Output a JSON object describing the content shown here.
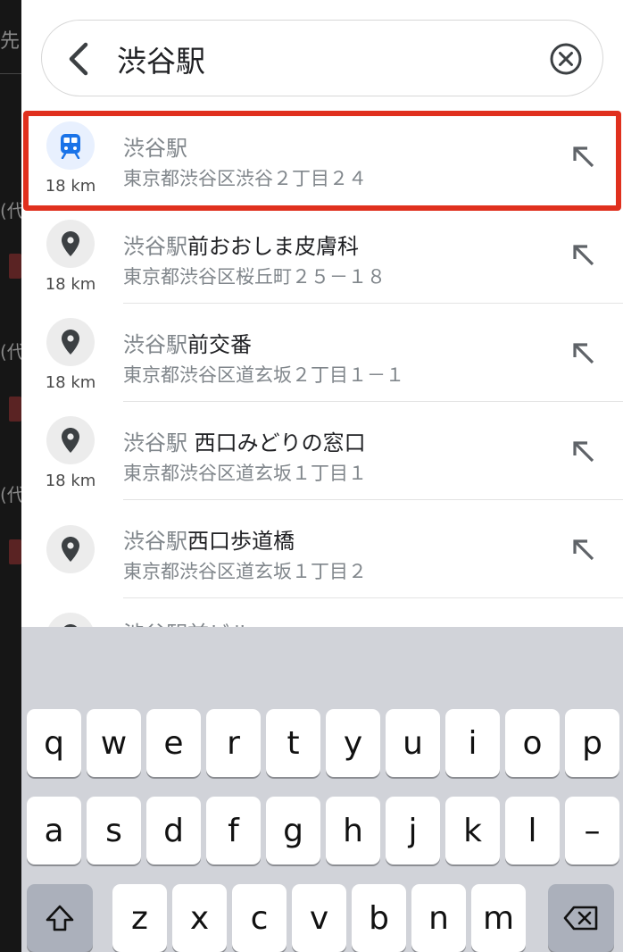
{
  "background": {
    "frag_top": "先",
    "frag_rows": [
      "(代",
      "(代",
      "(代"
    ]
  },
  "search": {
    "value": "渋谷駅",
    "back_icon": "chevron-left-icon",
    "clear_icon": "close-circle-icon"
  },
  "results": [
    {
      "icon": "train-icon",
      "distance": "18 km",
      "match": "渋谷駅",
      "rest": "",
      "address": "東京都渋谷区渋谷２丁目２４",
      "highlighted": true
    },
    {
      "icon": "place-pin-icon",
      "distance": "18 km",
      "match": "渋谷駅",
      "rest": "前おおしま皮膚科",
      "address": "東京都渋谷区桜丘町２５－１８"
    },
    {
      "icon": "place-pin-icon",
      "distance": "18 km",
      "match": "渋谷駅",
      "rest": "前交番",
      "address": "東京都渋谷区道玄坂２丁目１－１"
    },
    {
      "icon": "place-pin-icon",
      "distance": "18 km",
      "match": "渋谷駅",
      "rest": " 西口みどりの窓口",
      "address": "東京都渋谷区道玄坂１丁目１"
    },
    {
      "icon": "place-pin-icon",
      "distance": "",
      "match": "渋谷駅",
      "rest": "西口歩道橋",
      "address": "東京都渋谷区道玄坂１丁目２"
    }
  ],
  "partial_result": {
    "icon": "place-pin-icon",
    "text": "渋谷駅前ビル"
  },
  "keyboard": {
    "row1": [
      "q",
      "w",
      "e",
      "r",
      "t",
      "y",
      "u",
      "i",
      "o",
      "p"
    ],
    "row2": [
      "a",
      "s",
      "d",
      "f",
      "g",
      "h",
      "j",
      "k",
      "l",
      "–"
    ],
    "row3": [
      "z",
      "x",
      "c",
      "v",
      "b",
      "n",
      "m"
    ],
    "shift_icon": "shift-icon",
    "delete_icon": "backspace-icon"
  },
  "colors": {
    "highlight": "#e0301e",
    "train_icon": "#1a73e8"
  }
}
